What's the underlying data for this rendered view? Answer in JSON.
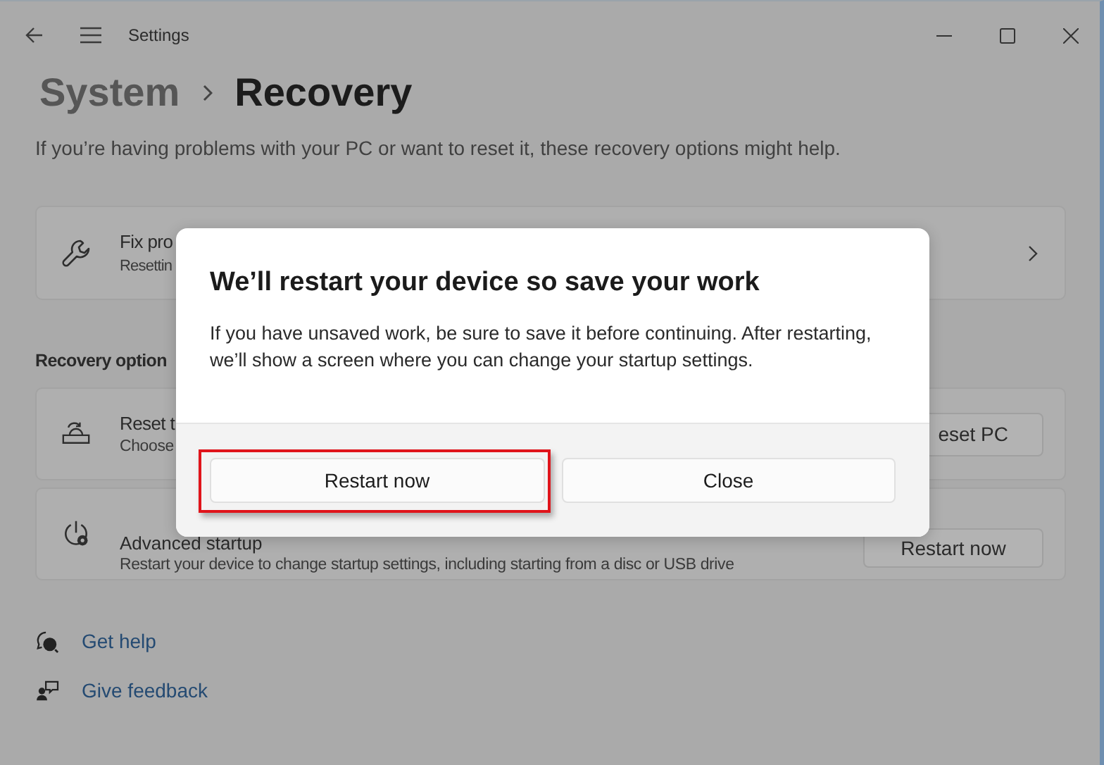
{
  "window": {
    "title": "Settings"
  },
  "breadcrumb": [
    {
      "label": "System",
      "current": false
    },
    {
      "label": "Recovery",
      "current": true
    }
  ],
  "description": "If you’re having problems with your PC or want to reset it, these recovery options might help.",
  "fix_card": {
    "title": "Fix pro",
    "subtitle": "Resettin"
  },
  "section_heading": "Recovery option",
  "options": [
    {
      "title": "Reset t",
      "subtitle": "Choose",
      "button": "eset PC"
    },
    {
      "title": "Advanced startup",
      "subtitle": "Restart your device to change startup settings, including starting from a disc or USB drive",
      "button": "Restart now"
    }
  ],
  "links": [
    {
      "label": "Get help"
    },
    {
      "label": "Give feedback"
    }
  ],
  "dialog": {
    "title": "We’ll restart your device so save your work",
    "message": "If you have unsaved work, be sure to save it before continuing. After restarting, we’ll show a screen where you can change your startup settings.",
    "buttons": [
      {
        "label": "Restart now",
        "highlighted": true
      },
      {
        "label": "Close",
        "highlighted": false
      }
    ]
  }
}
